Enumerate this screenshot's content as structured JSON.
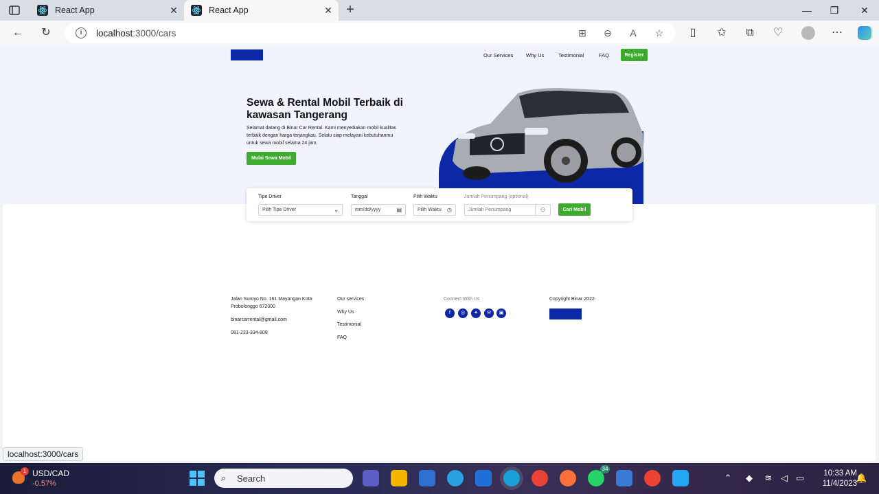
{
  "browser": {
    "tabs": [
      {
        "title": "React App",
        "active": false
      },
      {
        "title": "React App",
        "active": true
      }
    ],
    "url_host": "localhost",
    "url_path": ":3000/cars",
    "status_url": "localhost:3000/cars"
  },
  "navbar": {
    "links": [
      "Our Services",
      "Why Us",
      "Testimonial",
      "FAQ"
    ],
    "register_label": "Register",
    "brand_color": "#0d28a6",
    "accent_color": "#3eab2f"
  },
  "hero": {
    "title": "Sewa & Rental Mobil Terbaik di kawasan Tangerang",
    "description": "Selamat datang di Binar Car Rental. Kami menyediakan mobil kualitas terbaik dengan harga terjangkau. Selalu siap melayani kebutuhanmu untuk sewa mobil selama 24 jam.",
    "cta_label": "Mulai Sewa Mobil"
  },
  "search": {
    "driver_label": "Tipe Driver",
    "driver_value": "Pilih Tipe Driver",
    "date_label": "Tanggal",
    "date_placeholder": "mm/dd/yyyy",
    "time_label": "Pilih Waktu",
    "time_value": "Pilih Waktu",
    "passenger_label": "Jumlah Penumpang (optional)",
    "passenger_placeholder": "Jumlah Penumpang",
    "submit_label": "Cari Mobil"
  },
  "footer": {
    "address": "Jalan Suroyo No. 161 Mayangan Kota Probolonggo 672000",
    "email": "binarcarrental@gmail.com",
    "phone": "081-233-334-808",
    "links": [
      "Our services",
      "Why Us",
      "Testimonial",
      "FAQ"
    ],
    "connect_title": "Connect With Us",
    "copyright": "Copyright Binar 2022"
  },
  "taskbar": {
    "ticker_label": "USD/CAD",
    "ticker_change": "-0.57%",
    "ticker_badge": "1",
    "search_placeholder": "Search",
    "whatsapp_badge": "34",
    "time": "10:33 AM",
    "date": "11/4/2023"
  }
}
